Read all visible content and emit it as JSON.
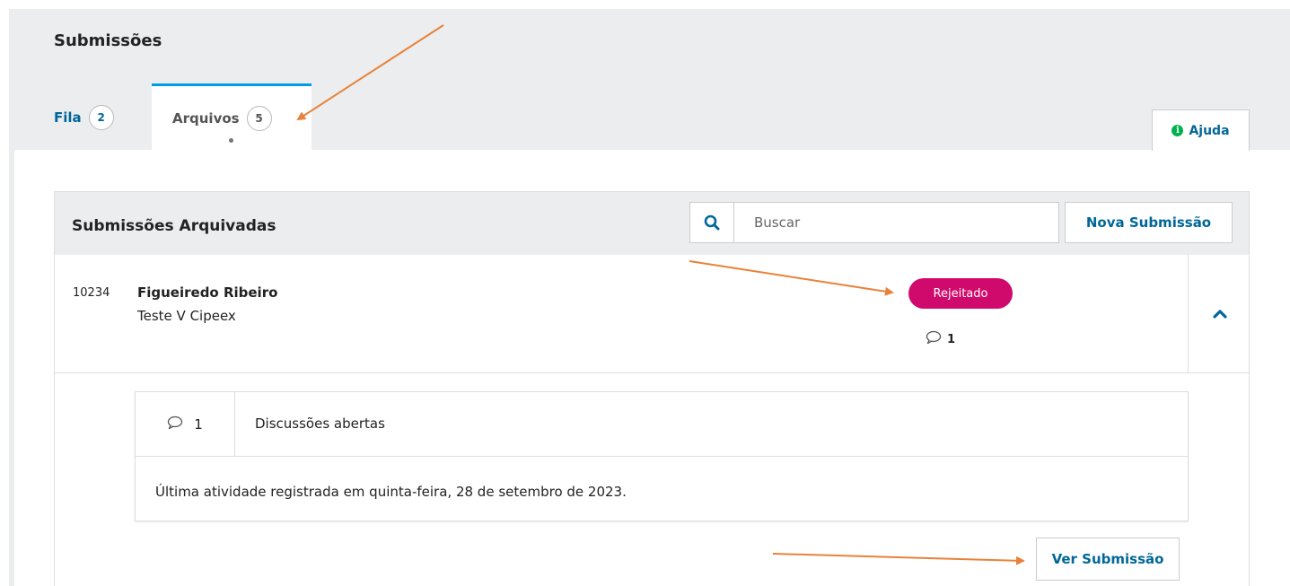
{
  "page": {
    "title": "Submissões"
  },
  "tabs": [
    {
      "label": "Fila",
      "count": "2",
      "active": false
    },
    {
      "label": "Arquivos",
      "count": "5",
      "active": true
    }
  ],
  "help": {
    "label": "Ajuda",
    "icon": "info-circle-icon",
    "icon_color": "#00b24e"
  },
  "panel": {
    "title": "Submissões Arquivadas",
    "search": {
      "placeholder": "Buscar",
      "value": ""
    },
    "new_submission_label": "Nova Submissão"
  },
  "submission": {
    "id": "10234",
    "author": "Figueiredo Ribeiro",
    "title": "Teste V Cipeex",
    "status": "Rejeitado",
    "status_color": "#d00a6c",
    "comment_count": "1",
    "details": {
      "open_discussions_count": "1",
      "open_discussions_label": "Discussões abertas",
      "last_activity": "Última atividade registrada em quinta-feira, 28 de setembro de 2023."
    },
    "view_label": "Ver Submissão"
  },
  "colors": {
    "link": "#006798",
    "tab_accent": "#009de5",
    "annotation_arrow": "#e8823a",
    "header_bg": "#ebedee"
  }
}
